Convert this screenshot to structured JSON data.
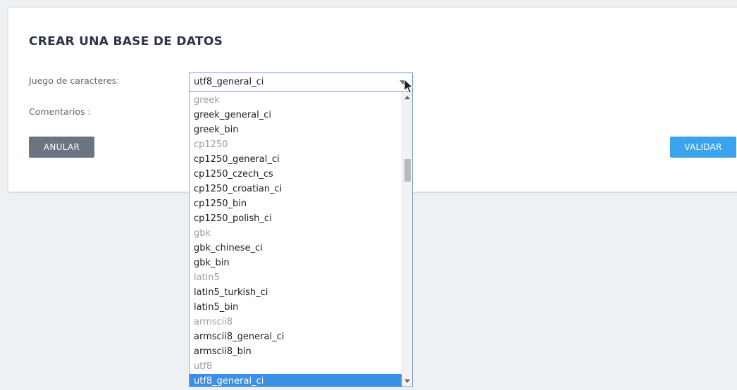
{
  "form": {
    "title": "CREAR UNA BASE DE DATOS",
    "charset_label": "Juego de caracteres:",
    "comments_label": "Comentarios :",
    "cancel_label": "ANULAR",
    "validate_label": "VALIDAR"
  },
  "charset_select": {
    "selected": "utf8_general_ci",
    "options": [
      {
        "label": "greek",
        "group": true
      },
      {
        "label": "greek_general_ci",
        "group": false
      },
      {
        "label": "greek_bin",
        "group": false
      },
      {
        "label": "cp1250",
        "group": true
      },
      {
        "label": "cp1250_general_ci",
        "group": false
      },
      {
        "label": "cp1250_czech_cs",
        "group": false
      },
      {
        "label": "cp1250_croatian_ci",
        "group": false
      },
      {
        "label": "cp1250_bin",
        "group": false
      },
      {
        "label": "cp1250_polish_ci",
        "group": false
      },
      {
        "label": "gbk",
        "group": true
      },
      {
        "label": "gbk_chinese_ci",
        "group": false
      },
      {
        "label": "gbk_bin",
        "group": false
      },
      {
        "label": "latin5",
        "group": true
      },
      {
        "label": "latin5_turkish_ci",
        "group": false
      },
      {
        "label": "latin5_bin",
        "group": false
      },
      {
        "label": "armscii8",
        "group": true
      },
      {
        "label": "armscii8_general_ci",
        "group": false
      },
      {
        "label": "armscii8_bin",
        "group": false
      },
      {
        "label": "utf8",
        "group": true
      },
      {
        "label": "utf8_general_ci",
        "group": false,
        "selected": true
      }
    ]
  },
  "colors": {
    "accent": "#3aa3ec",
    "cancel": "#6b7480",
    "selection": "#3b8fe5"
  }
}
